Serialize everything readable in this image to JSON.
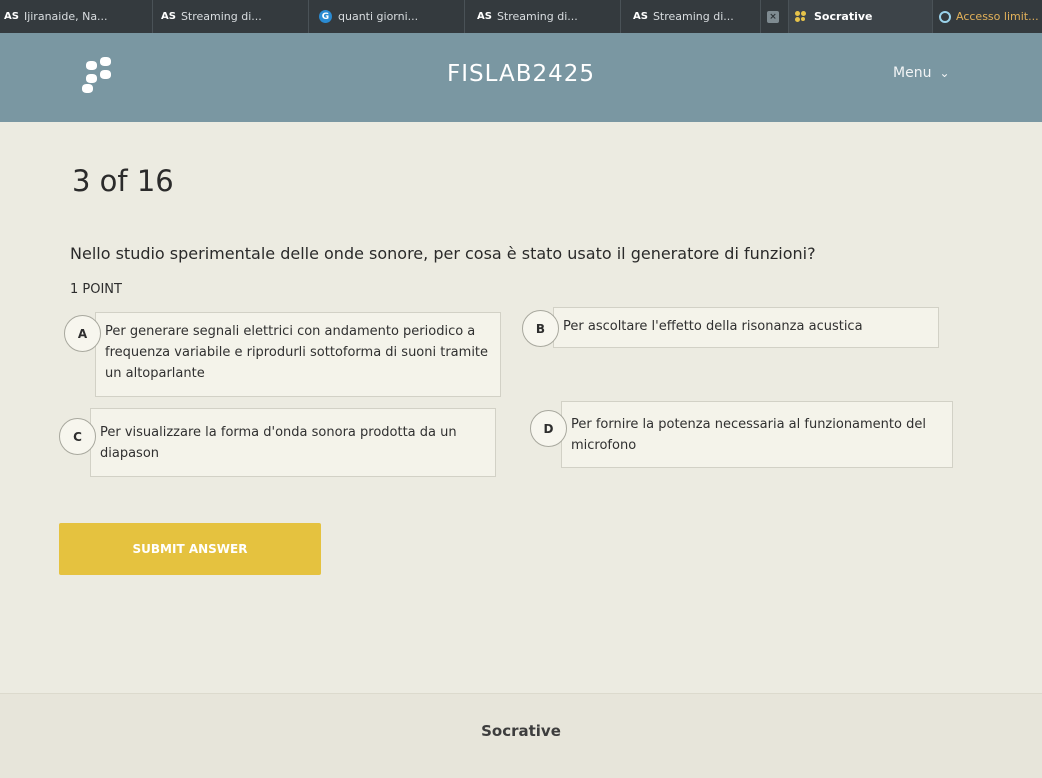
{
  "browser": {
    "tabs": [
      {
        "icon": "AS",
        "label": "Ijiranaide, Na..."
      },
      {
        "icon": "AS",
        "label": "Streaming di..."
      },
      {
        "icon": "G",
        "label": "quanti giorni..."
      },
      {
        "icon": "AS",
        "label": "Streaming di..."
      },
      {
        "icon": "AS",
        "label": "Streaming di..."
      },
      {
        "icon": "x",
        "label": ""
      },
      {
        "icon": "socrative-logo",
        "label": "Socrative"
      },
      {
        "icon": "globe",
        "label": "Accesso limit..."
      }
    ]
  },
  "header": {
    "title": "FISLAB2425",
    "menu_label": "Menu"
  },
  "quiz": {
    "counter": "3 of 16",
    "question": "Nello studio sperimentale delle onde sonore, per cosa è stato usato il generatore di funzioni?",
    "points": "1 POINT",
    "choices": [
      {
        "letter": "A",
        "text": "Per generare segnali elettrici con andamento periodico a frequenza variabile e riprodurli sottoforma di suoni tramite un altoparlante"
      },
      {
        "letter": "B",
        "text": "Per ascoltare l'effetto della risonanza acustica"
      },
      {
        "letter": "C",
        "text": "Per visualizzare la forma d'onda sonora prodotta da un diapason"
      },
      {
        "letter": "D",
        "text": "Per fornire la potenza necessaria al funzionamento del microfono"
      }
    ],
    "submit_label": "SUBMIT ANSWER"
  },
  "footer": {
    "brand": "Socrative"
  },
  "colors": {
    "header_bg": "#7a97a2",
    "submit_bg": "#e5c23f",
    "page_bg": "#ecebe1"
  }
}
